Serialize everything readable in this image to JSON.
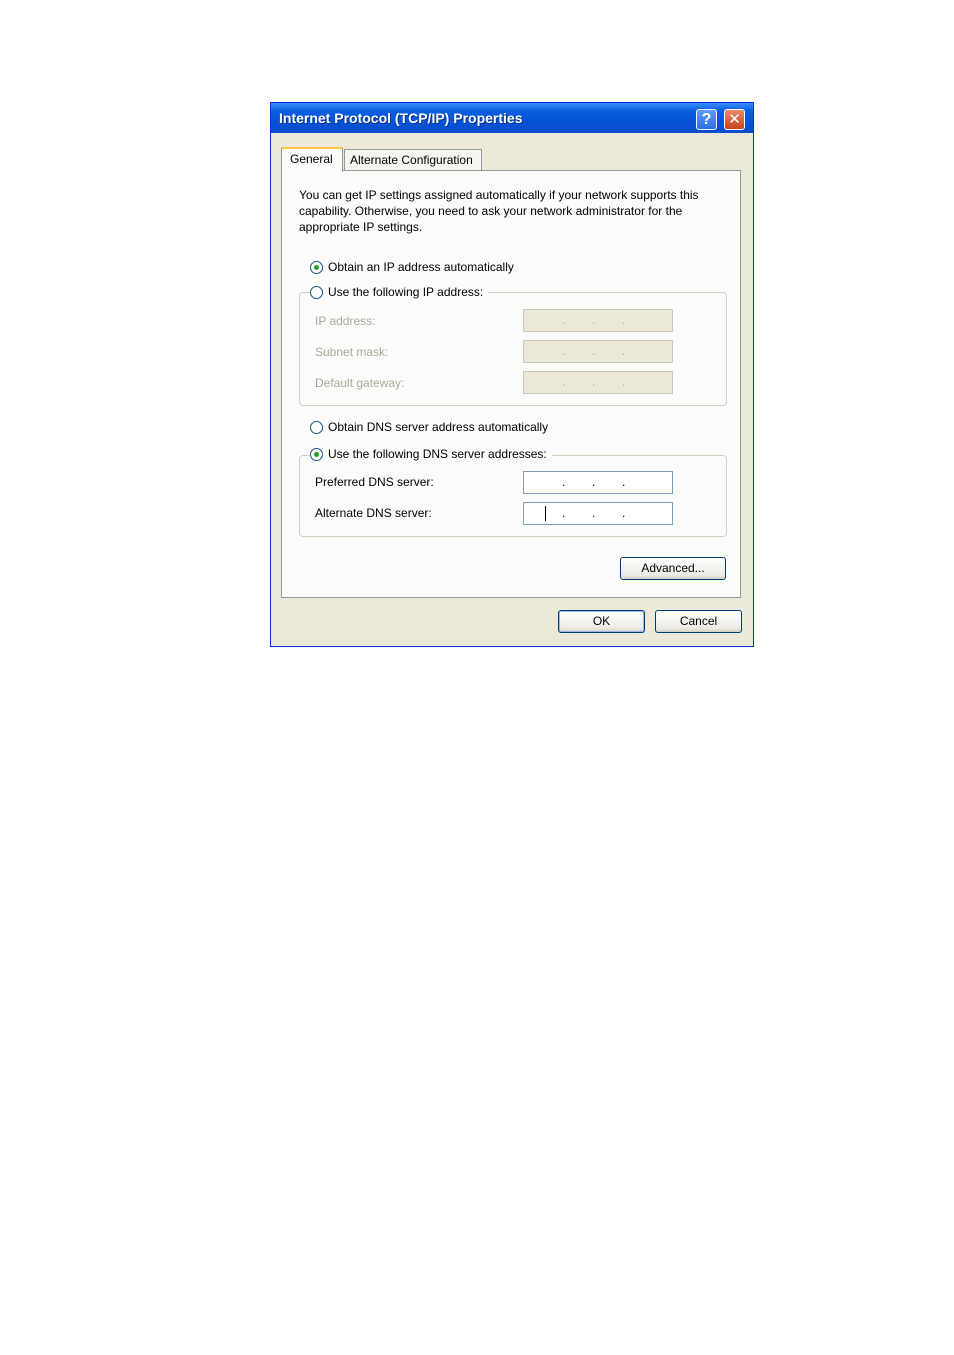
{
  "window": {
    "title": "Internet Protocol (TCP/IP) Properties",
    "help_button": "?",
    "close_button": "✕"
  },
  "tabs": [
    {
      "label": "General",
      "selected": true
    },
    {
      "label": "Alternate Configuration",
      "selected": false
    }
  ],
  "intro_text": "You can get IP settings assigned automatically if your network supports this capability. Otherwise, you need to ask your network administrator for the appropriate IP settings.",
  "ip_mode": {
    "auto_label": "Obtain an IP address automatically",
    "auto_selected": true,
    "manual_label": "Use the following IP address:",
    "manual_selected": false
  },
  "ip_fields": [
    {
      "label": "IP address:",
      "value": " .   . .",
      "enabled": false
    },
    {
      "label": "Subnet mask:",
      "value": " .   . .",
      "enabled": false
    },
    {
      "label": "Default gateway:",
      "value": " .   . .",
      "enabled": false
    }
  ],
  "dns_mode": {
    "auto_label": "Obtain DNS server address automatically",
    "auto_selected": false,
    "manual_label": "Use the following DNS server addresses:",
    "manual_selected": true
  },
  "dns_fields": [
    {
      "label": "Preferred DNS server:",
      "value": "",
      "enabled": true
    },
    {
      "label": "Alternate DNS server:",
      "value": "",
      "enabled": true
    }
  ],
  "buttons": {
    "advanced": "Advanced...",
    "ok": "OK",
    "cancel": "Cancel"
  }
}
